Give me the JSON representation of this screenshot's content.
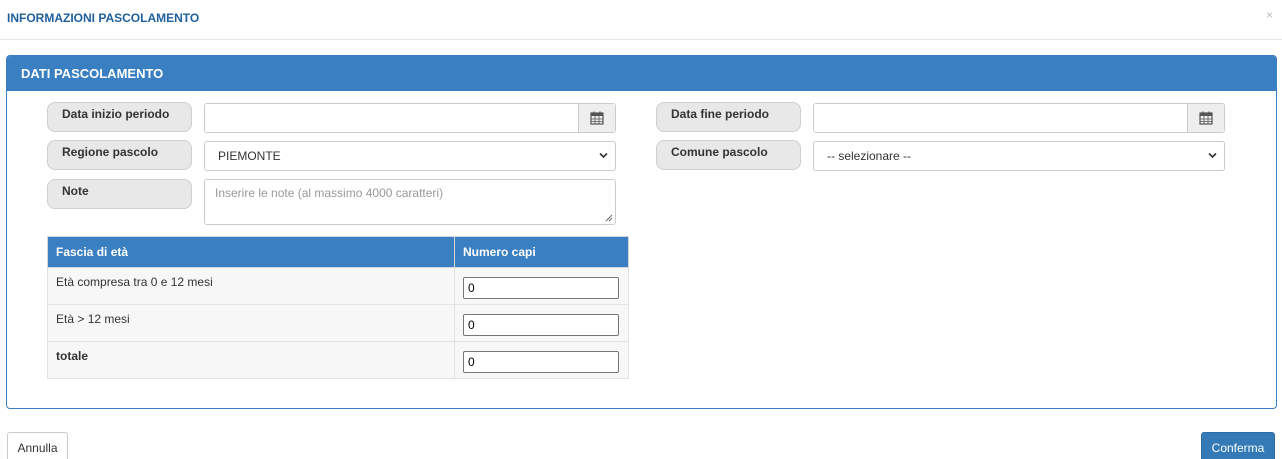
{
  "modal": {
    "title": "INFORMAZIONI PASCOLAMENTO",
    "close_glyph": "×"
  },
  "panel": {
    "heading": "DATI PASCOLAMENTO"
  },
  "form": {
    "data_inizio_label": "Data inizio periodo",
    "data_inizio_value": "",
    "data_fine_label": "Data fine periodo",
    "data_fine_value": "",
    "regione_label": "Regione pascolo",
    "regione_value": "PIEMONTE",
    "comune_label": "Comune pascolo",
    "comune_value": "-- selezionare --",
    "note_label": "Note",
    "note_placeholder": "Inserire le note (al massimo 4000 caratteri)"
  },
  "table": {
    "headers": [
      "Fascia di età",
      "Numero capi"
    ],
    "rows": [
      {
        "fascia": "Età compresa tra 0 e 12 mesi",
        "capi": "0"
      },
      {
        "fascia": "Età > 12 mesi",
        "capi": "0"
      },
      {
        "fascia": "totale",
        "capi": "0"
      }
    ]
  },
  "footer": {
    "cancel_label": "Annulla",
    "confirm_label": "Conferma"
  },
  "colors": {
    "accent": "#3a7fc1",
    "title": "#1f5f9e",
    "confirm_button": "#337ab7"
  },
  "icons": {
    "calendar": "calendar-icon",
    "chevron": "chevron-down-icon",
    "close": "close-icon",
    "resize": "resize-grip-icon"
  }
}
